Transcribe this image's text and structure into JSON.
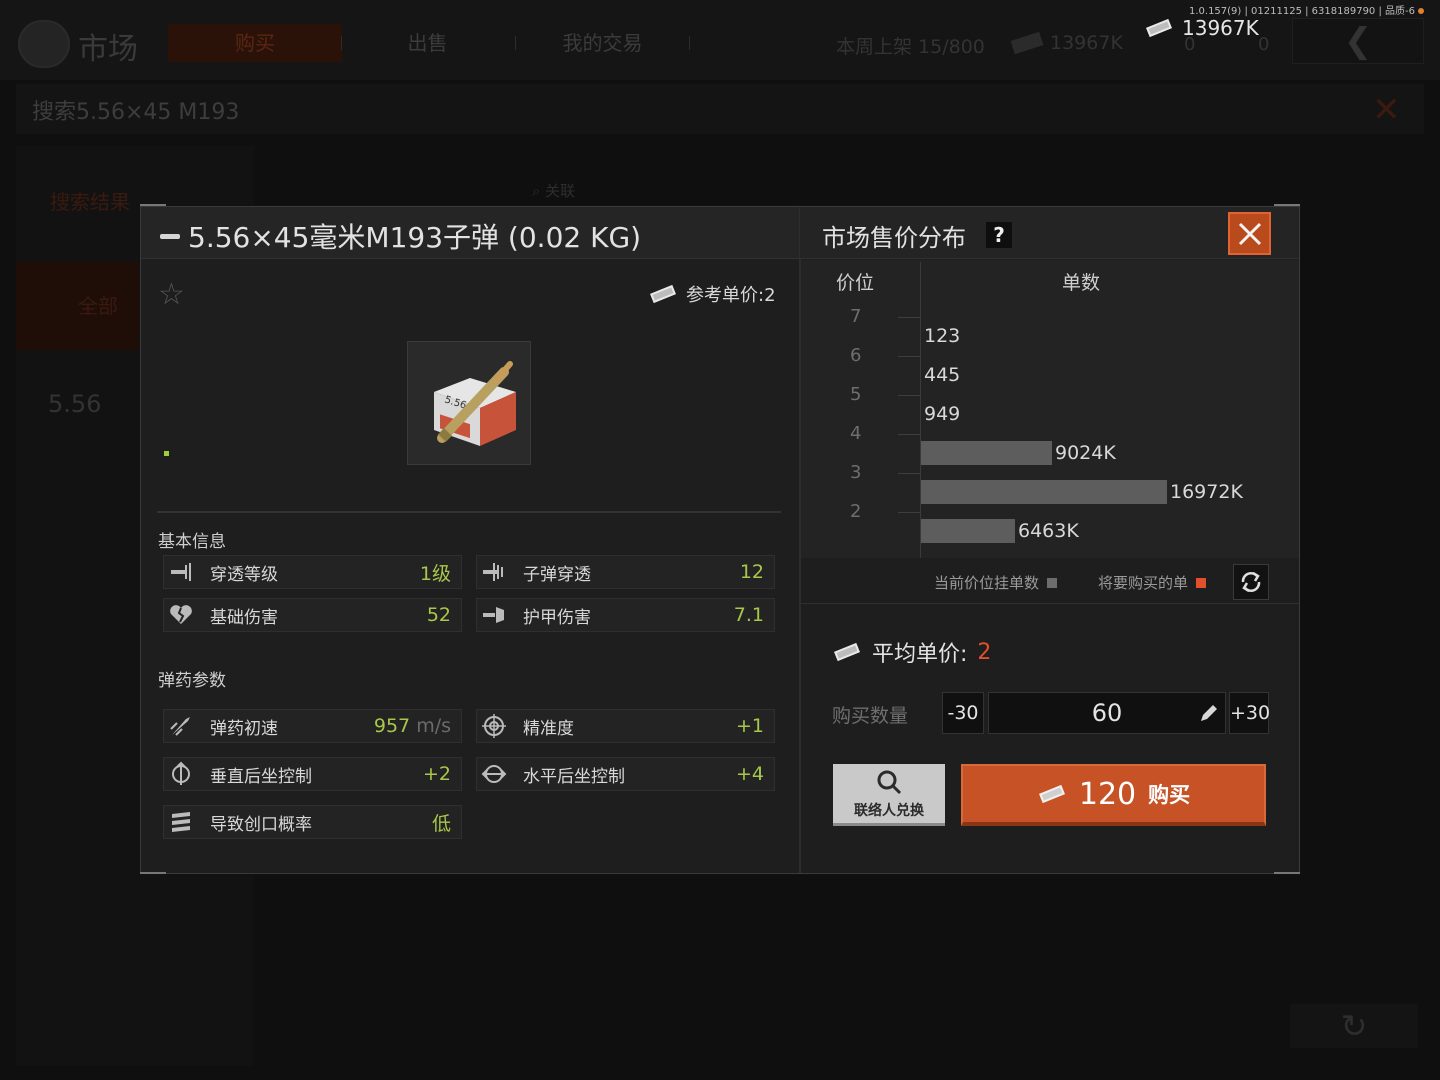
{
  "background": {
    "version_text": "1.0.157(9) | 01211125 | 6318189790 | 品质-6",
    "market_title": "市场",
    "tabs": [
      {
        "label": "购买"
      },
      {
        "label": "出售"
      },
      {
        "label": "我的交易"
      }
    ],
    "weekly_listing": "本周上架 15/800",
    "money_dim": "13967K",
    "counter_a": "0",
    "counter_b": "0",
    "search_text": "搜索5.56×45 M193",
    "search_results_label": "搜索结果",
    "filter_all": "全部",
    "list_item_partial": "5.56",
    "related_button": "关联"
  },
  "currency": {
    "amount": "13967K"
  },
  "modal": {
    "item_name": "5.56×45毫米M193子弹 (0.02 KG)",
    "reference_price": "参考单价:2",
    "basic_info_label": "基本信息",
    "ammo_params_label": "弹药参数",
    "basic_stats": [
      {
        "label": "穿透等级",
        "value": "1级",
        "icon": "penetration-icon"
      },
      {
        "label": "子弹穿透",
        "value": "12",
        "icon": "bullet-penetration-icon"
      },
      {
        "label": "基础伤害",
        "value": "52",
        "icon": "broken-heart-icon"
      },
      {
        "label": "护甲伤害",
        "value": "7.1",
        "icon": "armor-damage-icon"
      }
    ],
    "ammo_stats": [
      {
        "label": "弹药初速",
        "value": "957",
        "unit": "m/s",
        "icon": "muzzle-velocity-icon"
      },
      {
        "label": "精准度",
        "value": "+1",
        "icon": "crosshair-icon"
      },
      {
        "label": "垂直后坐控制",
        "value": "+2",
        "icon": "vertical-recoil-icon"
      },
      {
        "label": "水平后坐控制",
        "value": "+4",
        "icon": "horizontal-recoil-icon"
      },
      {
        "label": "导致创口概率",
        "value": "低",
        "icon": "bleed-icon"
      }
    ]
  },
  "distribution": {
    "title": "市场售价分布",
    "help": "?",
    "col_price": "价位",
    "col_orders": "单数",
    "legend_current": "当前价位挂单数",
    "legend_to_buy": "将要购买的单",
    "colors": {
      "bar": "#5d5d5d",
      "to_buy": "#e0502a"
    }
  },
  "chart_data": {
    "type": "bar",
    "orientation": "horizontal",
    "categories": [
      "7",
      "6",
      "5",
      "4",
      "3",
      "2"
    ],
    "series": [
      {
        "values": [
          123,
          445,
          949,
          9024000,
          16972000,
          6463000
        ]
      }
    ],
    "data_labels": [
      "123",
      "445",
      "949",
      "9024K",
      "16972K",
      "6463K"
    ],
    "ylabel": "价位",
    "xlabel": "单数"
  },
  "purchase": {
    "avg_price_label": "平均单价:",
    "avg_price_value": "2",
    "qty_label": "购买数量",
    "minus_label": "-30",
    "plus_label": "+30",
    "qty_value": "60",
    "contact_label": "联络人兑换",
    "buy_price": "120",
    "buy_label": "购买"
  }
}
